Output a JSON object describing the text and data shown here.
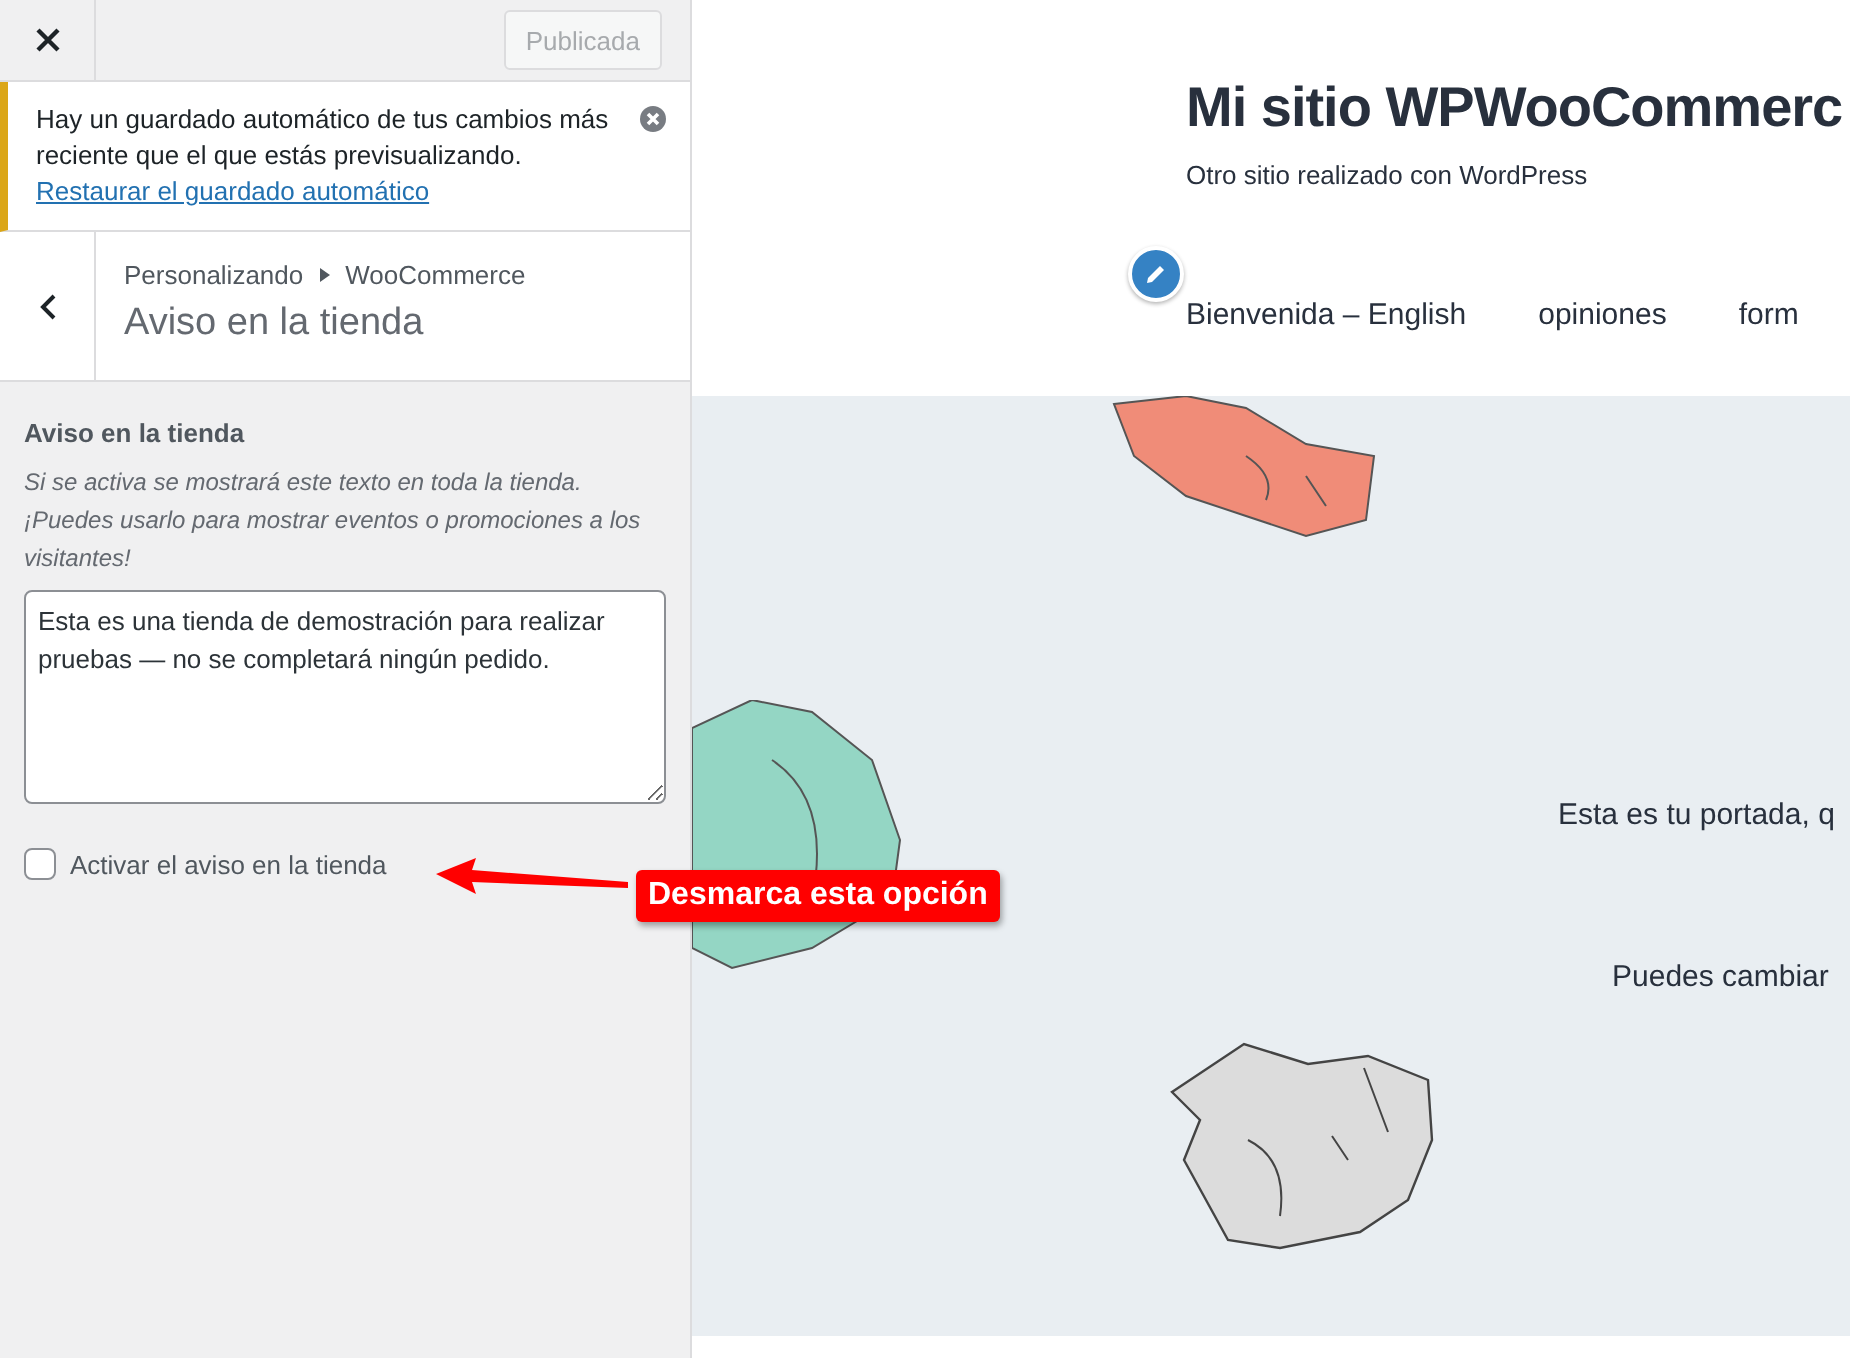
{
  "header": {
    "publish_button": {
      "label": "Publicada",
      "disabled": true
    }
  },
  "notice": {
    "text": "Hay un guardado automático de tus cambios más reciente que el que estás previsualizando.",
    "link": "Restaurar el guardado automático"
  },
  "section": {
    "breadcrumb": [
      "Personalizando",
      "WooCommerce"
    ],
    "title": "Aviso en la tienda"
  },
  "control": {
    "label": "Aviso en la tienda",
    "description": "Si se activa se mostrará este texto en toda la tienda. ¡Puedes usarlo para mostrar eventos o promociones a los visitantes!",
    "value": "Esta es una tienda de demostración para realizar pruebas — no se completará ningún pedido.",
    "checkbox": {
      "label": "Activar el aviso en la tienda",
      "checked": false
    }
  },
  "annotation": {
    "text": "Desmarca esta opción"
  },
  "preview": {
    "site_title": "Mi sitio WPWooCommerc",
    "tagline": "Otro sitio realizado con WordPress",
    "menu": [
      {
        "label": "Bienvenida – English"
      },
      {
        "label": "opiniones"
      },
      {
        "label": "form"
      }
    ],
    "hero_lines": [
      "Esta es tu portada, q",
      "Puedes cambiar"
    ]
  }
}
